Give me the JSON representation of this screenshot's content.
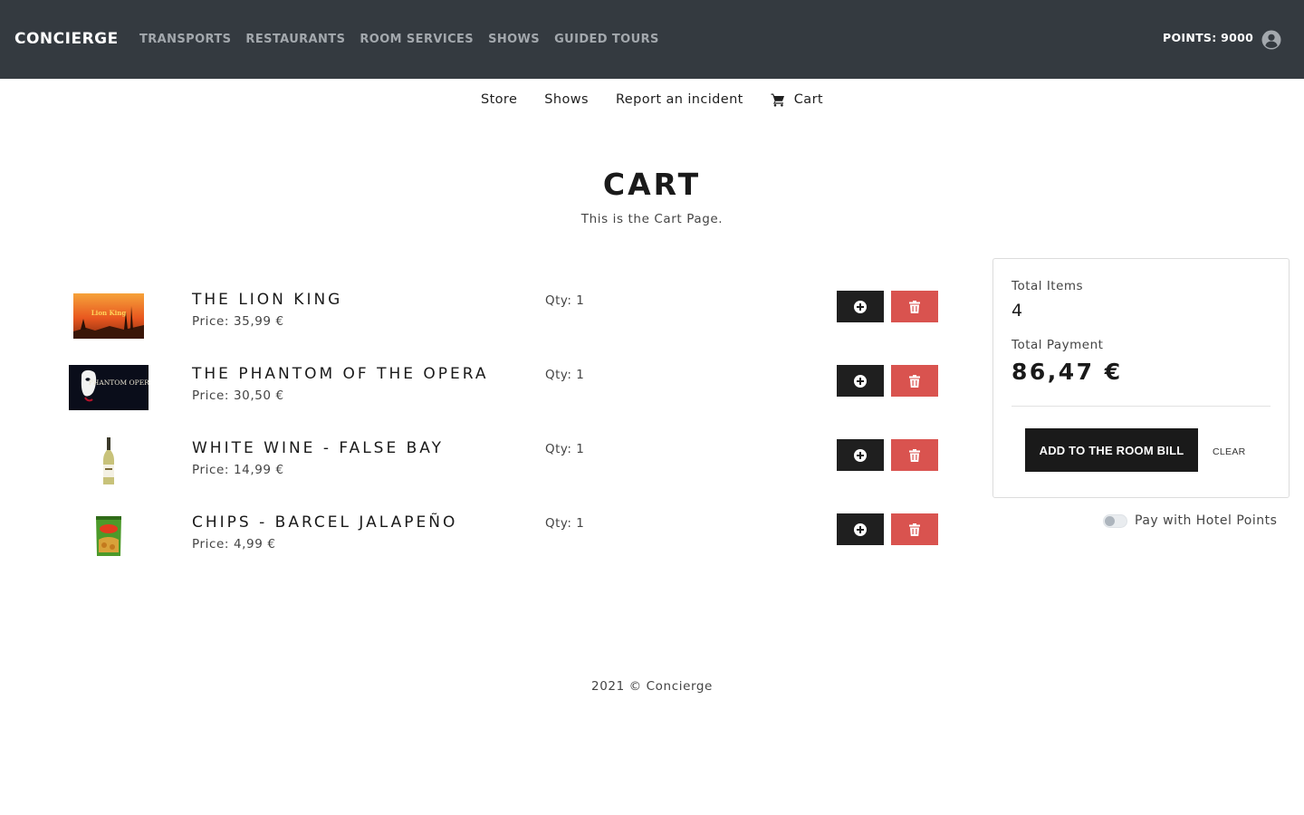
{
  "navbar": {
    "brand": "CONCIERGE",
    "links": [
      "TRANSPORTS",
      "RESTAURANTS",
      "ROOM SERVICES",
      "SHOWS",
      "GUIDED TOURS"
    ],
    "points": "POINTS: 9000",
    "user_icon": "user-circle-icon"
  },
  "subnav": {
    "links": [
      "Store",
      "Shows",
      "Report an incident"
    ],
    "cart_label": "Cart",
    "cart_icon": "shopping-cart-icon"
  },
  "page": {
    "title": "CART",
    "subtitle": "This is the Cart Page."
  },
  "items": [
    {
      "name": "THE LION KING",
      "price": "Price: 35,99 €",
      "qty": "Qty: 1",
      "thumb_text": "Lion King"
    },
    {
      "name": "THE PHANTOM OF THE OPERA",
      "price": "Price: 30,50 €",
      "qty": "Qty: 1",
      "thumb_text": "PHANTOM OPERA"
    },
    {
      "name": "WHITE WINE - FALSE BAY",
      "price": "Price: 14,99 €",
      "qty": "Qty: 1"
    },
    {
      "name": "CHIPS - BARCEL JALAPEÑO",
      "price": "Price: 4,99 €",
      "qty": "Qty: 1"
    }
  ],
  "summary": {
    "total_items_label": "Total Items",
    "total_items": "4",
    "total_payment_label": "Total Payment",
    "total_payment": "86,47 €",
    "room_bill_button": "ADD TO THE ROOM BILL",
    "clear_button": "CLEAR",
    "points_toggle_label": "Pay with Hotel Points"
  },
  "footer": "2021 © Concierge",
  "colors": {
    "navbar_bg": "#343a40",
    "dark_button": "#1f1f1f",
    "delete_button": "#d9534f"
  }
}
